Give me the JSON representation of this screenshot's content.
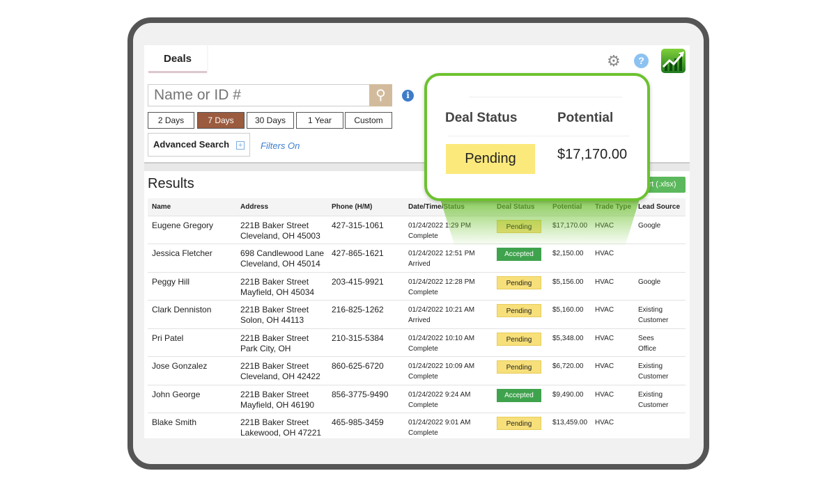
{
  "tab": "Deals",
  "search": {
    "placeholder": "Name or ID #"
  },
  "ranges": [
    {
      "label": "2 Days",
      "active": false
    },
    {
      "label": "7 Days",
      "active": true
    },
    {
      "label": "30 Days",
      "active": false
    },
    {
      "label": "1 Year",
      "active": false
    },
    {
      "label": "Custom",
      "active": false
    }
  ],
  "advanced_search": "Advanced Search",
  "filters_on": "Filters On",
  "results_title": "Results",
  "export_label": "ort (.xlsx)",
  "columns": [
    "Name",
    "Address",
    "Phone (H/M)",
    "Date/Time/Status",
    "Deal Status",
    "Potential",
    "Trade Type",
    "Lead Source"
  ],
  "rows": [
    {
      "name": "Eugene Gregory",
      "addr1": "221B Baker Street",
      "addr2": "Cleveland, OH 45003",
      "phone": "427-315-1061",
      "date": "01/24/2022 1:29 PM",
      "status": "Complete",
      "deal": "Pending",
      "potential": "$17,170.00",
      "trade": "HVAC",
      "lead": "Google"
    },
    {
      "name": "Jessica Fletcher",
      "addr1": "698 Candlewood Lane",
      "addr2": "Cleveland, OH 45014",
      "phone": "427-865-1621",
      "date": "01/24/2022 12:51 PM",
      "status": "Arrived",
      "deal": "Accepted",
      "potential": "$2,150.00",
      "trade": "HVAC",
      "lead": ""
    },
    {
      "name": "Peggy Hill",
      "addr1": "221B Baker Street",
      "addr2": "Mayfield, OH 45034",
      "phone": "203-415-9921",
      "date": "01/24/2022 12:28 PM",
      "status": "Complete",
      "deal": "Pending",
      "potential": "$5,156.00",
      "trade": "HVAC",
      "lead": "Google"
    },
    {
      "name": "Clark Denniston",
      "addr1": "221B Baker Street",
      "addr2": "Solon, OH 44113",
      "phone": "216-825-1262",
      "date": "01/24/2022 10:21 AM",
      "status": "Arrived",
      "deal": "Pending",
      "potential": "$5,160.00",
      "trade": "HVAC",
      "lead": "Existing Customer"
    },
    {
      "name": "Pri Patel",
      "addr1": "221B Baker Street",
      "addr2": "Park City, OH",
      "phone": "210-315-5384",
      "date": "01/24/2022 10:10 AM",
      "status": "Complete",
      "deal": "Pending",
      "potential": "$5,348.00",
      "trade": "HVAC",
      "lead": "Sees Office"
    },
    {
      "name": "Jose Gonzalez",
      "addr1": "221B Baker Street",
      "addr2": "Cleveland, OH 42422",
      "phone": "860-625-6720",
      "date": "01/24/2022 10:09 AM",
      "status": "Complete",
      "deal": "Pending",
      "potential": "$6,720.00",
      "trade": "HVAC",
      "lead": "Existing Customer"
    },
    {
      "name": "John George",
      "addr1": "221B Baker Street",
      "addr2": "Mayfield, OH 46190",
      "phone": "856-3775-9490",
      "date": "01/24/2022 9:24 AM",
      "status": "Complete",
      "deal": "Accepted",
      "potential": "$9,490.00",
      "trade": "HVAC",
      "lead": "Existing Customer"
    },
    {
      "name": "Blake Smith",
      "addr1": "221B Baker Street",
      "addr2": "Lakewood, OH 47221",
      "phone": "465-985-3459",
      "date": "01/24/2022 9:01 AM",
      "status": "Complete",
      "deal": "Pending",
      "potential": "$13,459.00",
      "trade": "HVAC",
      "lead": ""
    }
  ],
  "callout": {
    "deal_status_header": "Deal Status",
    "potential_header": "Potential",
    "deal_status": "Pending",
    "potential": "$17,170.00"
  },
  "colors": {
    "accent_green": "#6cc22e",
    "active_range": "#9b5b3e",
    "pending": "#f7e07a",
    "accepted": "#3fa34d"
  }
}
